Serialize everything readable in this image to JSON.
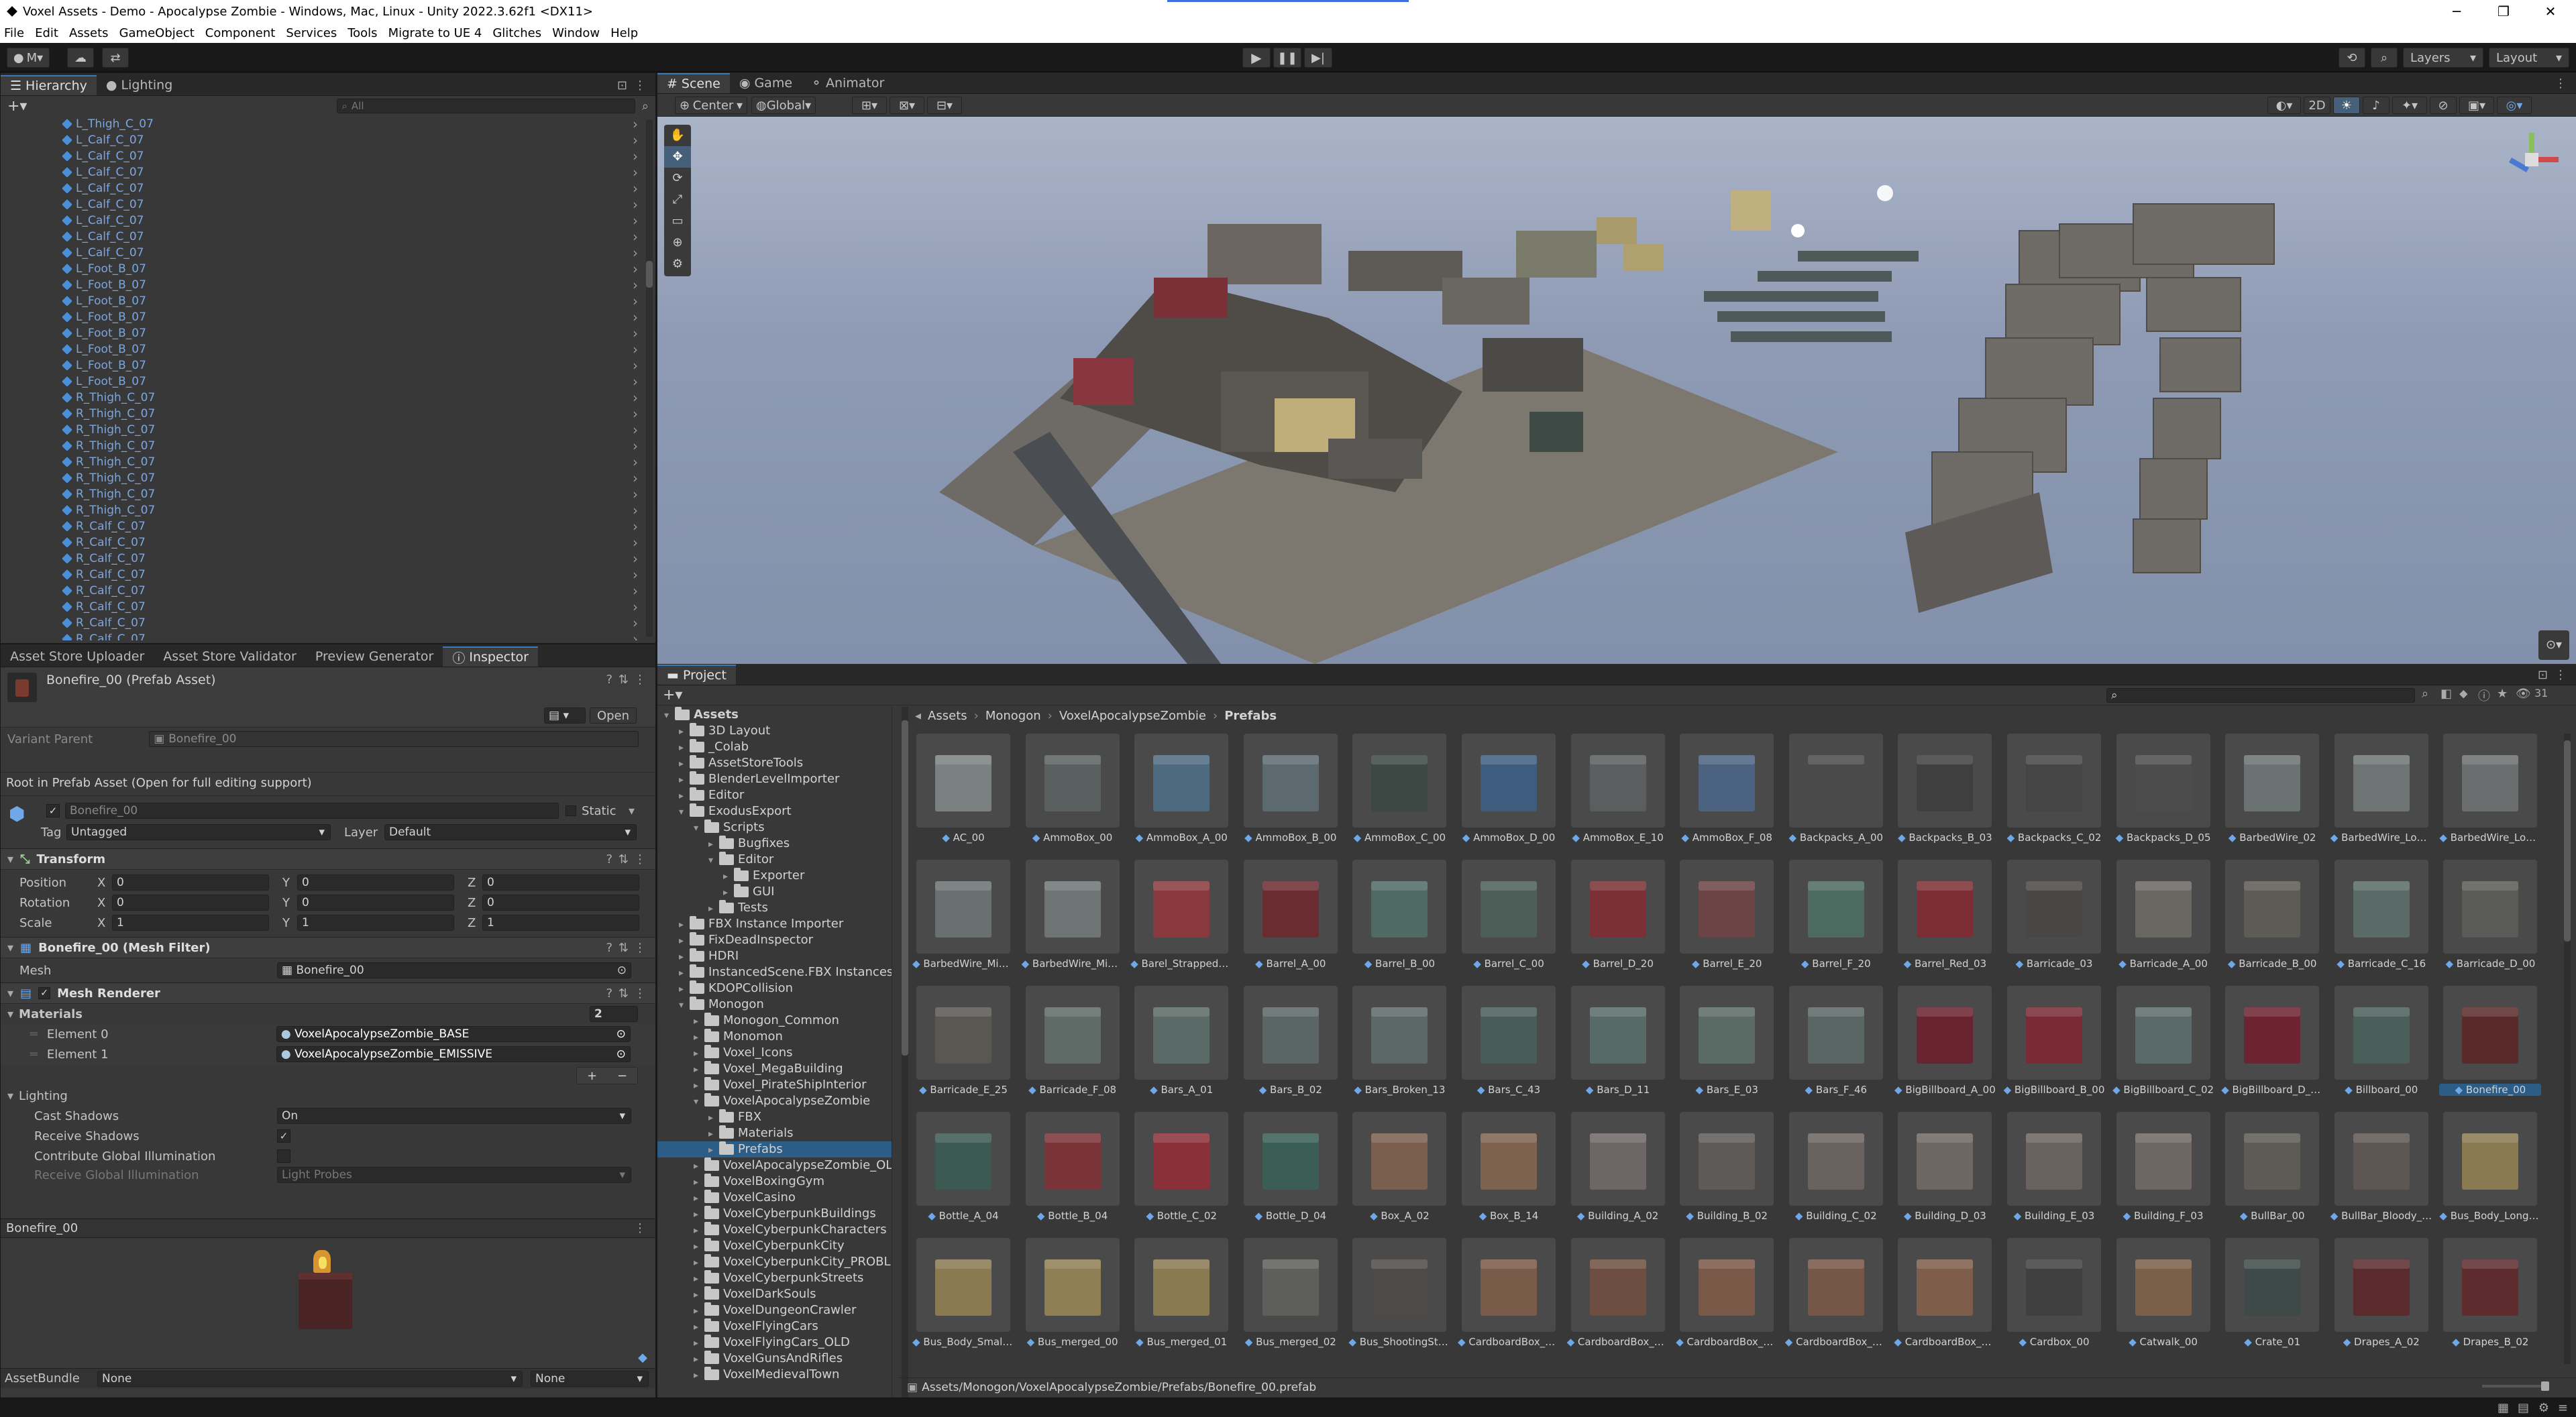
{
  "window": {
    "title": "Voxel Assets - Demo - Apocalypse Zombie - Windows, Mac, Linux - Unity 2022.3.62f1 <DX11>",
    "controls": [
      "─",
      "❐",
      "✕"
    ]
  },
  "menu": [
    "File",
    "Edit",
    "Assets",
    "GameObject",
    "Component",
    "Services",
    "Tools",
    "Migrate to UE 4",
    "Glitches",
    "Window",
    "Help"
  ],
  "toolbar": {
    "account_label": "M",
    "layers_label": "Layers",
    "layout_label": "Layout"
  },
  "hierarchy": {
    "tabs": [
      "Hierarchy",
      "Lighting"
    ],
    "search_placeholder": "All",
    "items": [
      "L_Thigh_C_07",
      "L_Calf_C_07",
      "L_Calf_C_07",
      "L_Calf_C_07",
      "L_Calf_C_07",
      "L_Calf_C_07",
      "L_Calf_C_07",
      "L_Calf_C_07",
      "L_Calf_C_07",
      "L_Foot_B_07",
      "L_Foot_B_07",
      "L_Foot_B_07",
      "L_Foot_B_07",
      "L_Foot_B_07",
      "L_Foot_B_07",
      "L_Foot_B_07",
      "L_Foot_B_07",
      "R_Thigh_C_07",
      "R_Thigh_C_07",
      "R_Thigh_C_07",
      "R_Thigh_C_07",
      "R_Thigh_C_07",
      "R_Thigh_C_07",
      "R_Thigh_C_07",
      "R_Thigh_C_07",
      "R_Calf_C_07",
      "R_Calf_C_07",
      "R_Calf_C_07",
      "R_Calf_C_07",
      "R_Calf_C_07",
      "R_Calf_C_07",
      "R_Calf_C_07",
      "R_Calf_C_07"
    ]
  },
  "inspector": {
    "tabs": [
      "Asset Store Uploader",
      "Asset Store Validator",
      "Preview Generator",
      "Inspector"
    ],
    "asset_title": "Bonefire_00 (Prefab Asset)",
    "open_label": "Open",
    "variant_parent_label": "Variant Parent",
    "variant_parent_value": "Bonefire_00",
    "root_notice": "Root in Prefab Asset (Open for full editing support)",
    "object_name": "Bonefire_00",
    "static_label": "Static",
    "tag_label": "Tag",
    "tag_value": "Untagged",
    "layer_label": "Layer",
    "layer_value": "Default",
    "transform": {
      "title": "Transform",
      "rows": [
        {
          "label": "Position",
          "x": "0",
          "y": "0",
          "z": "0"
        },
        {
          "label": "Rotation",
          "x": "0",
          "y": "0",
          "z": "0"
        },
        {
          "label": "Scale",
          "x": "1",
          "y": "1",
          "z": "1"
        }
      ]
    },
    "mesh_filter": {
      "title": "Bonefire_00 (Mesh Filter)",
      "mesh_label": "Mesh",
      "mesh_value": "Bonefire_00"
    },
    "mesh_renderer": {
      "title": "Mesh Renderer",
      "materials_label": "Materials",
      "materials_count": "2",
      "elements": [
        {
          "label": "Element 0",
          "value": "VoxelApocalypseZombie_BASE"
        },
        {
          "label": "Element 1",
          "value": "VoxelApocalypseZombie_EMISSIVE"
        }
      ]
    },
    "lighting": {
      "title": "Lighting",
      "cast_shadows_label": "Cast Shadows",
      "cast_shadows_value": "On",
      "receive_shadows_label": "Receive Shadows",
      "contribute_gi_label": "Contribute Global Illumination",
      "receive_gi_label": "Receive Global Illumination",
      "receive_gi_value": "Light Probes"
    },
    "preview_title": "Bonefire_00",
    "assetbundle_label": "AssetBundle",
    "assetbundle_value": "None",
    "assetbundle_variant": "None"
  },
  "scene": {
    "tabs": [
      "Scene",
      "Game",
      "Animator"
    ],
    "pivot_label": "Center",
    "space_label": "Global",
    "mode_2d": "2D"
  },
  "project": {
    "tab": "Project",
    "search_count": "31",
    "breadcrumb": [
      "Assets",
      "Monogon",
      "VoxelApocalypseZombie",
      "Prefabs"
    ],
    "status_path": "Assets/Monogon/VoxelApocalypseZombie/Prefabs/Bonefire_00.prefab",
    "tree": [
      {
        "label": "Assets",
        "depth": 0,
        "open": true
      },
      {
        "label": "3D Layout",
        "depth": 1
      },
      {
        "label": "_Colab",
        "depth": 1
      },
      {
        "label": "AssetStoreTools",
        "depth": 1
      },
      {
        "label": "BlenderLevelImporter",
        "depth": 1
      },
      {
        "label": "Editor",
        "depth": 1
      },
      {
        "label": "ExodusExport",
        "depth": 1,
        "open": true
      },
      {
        "label": "Scripts",
        "depth": 2,
        "open": true
      },
      {
        "label": "Bugfixes",
        "depth": 3
      },
      {
        "label": "Editor",
        "depth": 3,
        "open": true
      },
      {
        "label": "Exporter",
        "depth": 4
      },
      {
        "label": "GUI",
        "depth": 4
      },
      {
        "label": "Tests",
        "depth": 3
      },
      {
        "label": "FBX Instance Importer",
        "depth": 1
      },
      {
        "label": "FixDeadInspector",
        "depth": 1
      },
      {
        "label": "HDRI",
        "depth": 1
      },
      {
        "label": "InstancedScene.FBX Instances",
        "depth": 1
      },
      {
        "label": "KDOPCollision",
        "depth": 1
      },
      {
        "label": "Monogon",
        "depth": 1,
        "open": true
      },
      {
        "label": "Monogon_Common",
        "depth": 2
      },
      {
        "label": "Monomon",
        "depth": 2
      },
      {
        "label": "Voxel_Icons",
        "depth": 2
      },
      {
        "label": "Voxel_MegaBuilding",
        "depth": 2
      },
      {
        "label": "Voxel_PirateShipInterior",
        "depth": 2
      },
      {
        "label": "VoxelApocalypseZombie",
        "depth": 2,
        "open": true
      },
      {
        "label": "FBX",
        "depth": 3
      },
      {
        "label": "Materials",
        "depth": 3
      },
      {
        "label": "Prefabs",
        "depth": 3,
        "selected": true
      },
      {
        "label": "VoxelApocalypseZombie_OLD",
        "depth": 2
      },
      {
        "label": "VoxelBoxingGym",
        "depth": 2
      },
      {
        "label": "VoxelCasino",
        "depth": 2
      },
      {
        "label": "VoxelCyberpunkBuildings",
        "depth": 2
      },
      {
        "label": "VoxelCyberpunkCharacters",
        "depth": 2
      },
      {
        "label": "VoxelCyberpunkCity",
        "depth": 2
      },
      {
        "label": "VoxelCyberpunkCity_PROBLEM",
        "depth": 2
      },
      {
        "label": "VoxelCyberpunkStreets",
        "depth": 2
      },
      {
        "label": "VoxelDarkSouls",
        "depth": 2
      },
      {
        "label": "VoxelDungeonCrawler",
        "depth": 2
      },
      {
        "label": "VoxelFlyingCars",
        "depth": 2
      },
      {
        "label": "VoxelFlyingCars_OLD",
        "depth": 2
      },
      {
        "label": "VoxelGunsAndRifles",
        "depth": 2
      },
      {
        "label": "VoxelMedievalTown",
        "depth": 2
      }
    ],
    "assets": [
      {
        "name": "AC_00",
        "color": "#7b8080"
      },
      {
        "name": "AmmoBox_00",
        "color": "#5a6060"
      },
      {
        "name": "AmmoBox_A_00",
        "color": "#4e6a7e"
      },
      {
        "name": "AmmoBox_B_00",
        "color": "#5c6a70"
      },
      {
        "name": "AmmoBox_C_00",
        "color": "#3d4844"
      },
      {
        "name": "AmmoBox_D_00",
        "color": "#3e5c7e"
      },
      {
        "name": "AmmoBox_E_10",
        "color": "#5a5e5e"
      },
      {
        "name": "AmmoBox_F_08",
        "color": "#4b6280"
      },
      {
        "name": "Backpacks_A_00",
        "color": "#4a4a4a"
      },
      {
        "name": "Backpacks_B_03",
        "color": "#3f3f3f"
      },
      {
        "name": "Backpacks_C_02",
        "color": "#454545"
      },
      {
        "name": "Backpacks_D_05",
        "color": "#4c4c4c"
      },
      {
        "name": "BarbedWire_02",
        "color": "#6a7272"
      },
      {
        "name": "BarbedWire_Long...",
        "color": "#6e7474"
      },
      {
        "name": "BarbedWire_Long...",
        "color": "#6a6e6e"
      },
      {
        "name": "BarbedWire_Mid_...",
        "color": "#6a7070"
      },
      {
        "name": "BarbedWire_Mid_...",
        "color": "#6e7474"
      },
      {
        "name": "Barel_Strapped_...",
        "color": "#8a3a3e"
      },
      {
        "name": "Barrel_A_00",
        "color": "#6a2c30"
      },
      {
        "name": "Barrel_B_00",
        "color": "#4f6a64"
      },
      {
        "name": "Barrel_C_00",
        "color": "#4d5e58"
      },
      {
        "name": "Barrel_D_20",
        "color": "#7a3034"
      },
      {
        "name": "Barrel_E_20",
        "color": "#6c4446"
      },
      {
        "name": "Barrel_F_20",
        "color": "#4c6a60"
      },
      {
        "name": "Barrel_Red_03",
        "color": "#7c2e34"
      },
      {
        "name": "Barricade_03",
        "color": "#4a4646"
      },
      {
        "name": "Barricade_A_00",
        "color": "#6a6662"
      },
      {
        "name": "Barricade_B_00",
        "color": "#5e5a56"
      },
      {
        "name": "Barricade_C_16",
        "color": "#5a6a66"
      },
      {
        "name": "Barricade_D_00",
        "color": "#5a5a56"
      },
      {
        "name": "Barricade_E_25",
        "color": "#5a5652"
      },
      {
        "name": "Barricade_F_08",
        "color": "#5e6a66"
      },
      {
        "name": "Bars_A_01",
        "color": "#5a6a66"
      },
      {
        "name": "Bars_B_02",
        "color": "#5a6664"
      },
      {
        "name": "Bars_Broken_13",
        "color": "#5c6866"
      },
      {
        "name": "Bars_C_43",
        "color": "#4a5c58"
      },
      {
        "name": "Bars_D_11",
        "color": "#586a66"
      },
      {
        "name": "Bars_E_03",
        "color": "#5a6a64"
      },
      {
        "name": "Bars_F_46",
        "color": "#5a6664"
      },
      {
        "name": "BigBillboard_A_00",
        "color": "#6a2430"
      },
      {
        "name": "BigBillboard_B_00",
        "color": "#7a2a34"
      },
      {
        "name": "BigBillboard_C_02",
        "color": "#5a6a6a"
      },
      {
        "name": "BigBillboard_D_00",
        "color": "#6e2430"
      },
      {
        "name": "Billboard_00",
        "color": "#4a5e5a"
      },
      {
        "name": "Bonefire_00",
        "color": "#5a2a2a",
        "selected": true
      },
      {
        "name": "Bottle_A_04",
        "color": "#3c5a52"
      },
      {
        "name": "Bottle_B_04",
        "color": "#7a3438"
      },
      {
        "name": "Bottle_C_02",
        "color": "#8a3038"
      },
      {
        "name": "Bottle_D_04",
        "color": "#3a5e56"
      },
      {
        "name": "Box_A_02",
        "color": "#7a5e4e"
      },
      {
        "name": "Box_B_14",
        "color": "#7e6250"
      },
      {
        "name": "Building_A_02",
        "color": "#6e6664"
      },
      {
        "name": "Building_B_02",
        "color": "#5e5a58"
      },
      {
        "name": "Building_C_02",
        "color": "#6a625e"
      },
      {
        "name": "Building_D_03",
        "color": "#6e6660"
      },
      {
        "name": "Building_E_03",
        "color": "#6a625e"
      },
      {
        "name": "Building_F_03",
        "color": "#6e6662"
      },
      {
        "name": "BullBar_00",
        "color": "#5e5a56"
      },
      {
        "name": "BullBar_Bloody_00",
        "color": "#5e5652"
      },
      {
        "name": "Bus_Body_Long_...",
        "color": "#8a7a52"
      },
      {
        "name": "Bus_Body_Small_...",
        "color": "#8a7a52"
      },
      {
        "name": "Bus_merged_00",
        "color": "#8e7e54"
      },
      {
        "name": "Bus_merged_01",
        "color": "#8a7a52"
      },
      {
        "name": "Bus_merged_02",
        "color": "#5e5e5a"
      },
      {
        "name": "Bus_ShootingStat...",
        "color": "#4e4a48"
      },
      {
        "name": "CardboardBox_A...",
        "color": "#7a5a48"
      },
      {
        "name": "CardboardBox_B...",
        "color": "#6e4e40"
      },
      {
        "name": "CardboardBox_C...",
        "color": "#7a5848"
      },
      {
        "name": "CardboardBox_D...",
        "color": "#765646"
      },
      {
        "name": "CardboardBox_E_...",
        "color": "#7e5e4a"
      },
      {
        "name": "Cardbox_00",
        "color": "#404040"
      },
      {
        "name": "Catwalk_00",
        "color": "#7a6048"
      },
      {
        "name": "Crate_01",
        "color": "#3e4a48"
      },
      {
        "name": "Drapes_A_02",
        "color": "#5a2a2c"
      },
      {
        "name": "Drapes_B_02",
        "color": "#5e2c2e"
      }
    ]
  }
}
